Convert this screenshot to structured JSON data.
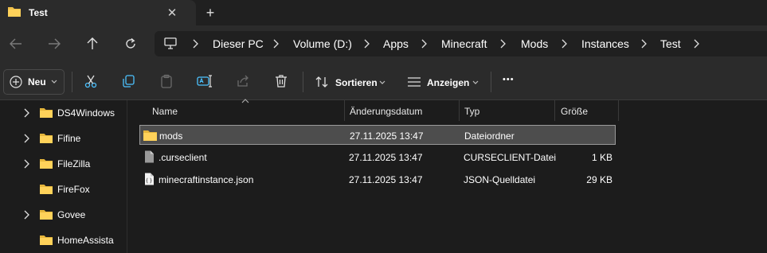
{
  "tab": {
    "title": "Test",
    "close_glyph": "✕",
    "new_tab_glyph": "+"
  },
  "nav": {
    "breadcrumbs": [
      "Dieser PC",
      "Volume (D:)",
      "Apps",
      "Minecraft",
      "Mods",
      "Instances",
      "Test"
    ]
  },
  "commands": {
    "new_label": "Neu",
    "sort_label": "Sortieren",
    "view_label": "Anzeigen",
    "more_glyph": "•••"
  },
  "sidebar": {
    "items": [
      {
        "label": "DS4Windows",
        "expandable": true
      },
      {
        "label": "Fifine",
        "expandable": true
      },
      {
        "label": "FileZilla",
        "expandable": true
      },
      {
        "label": "FireFox",
        "expandable": false
      },
      {
        "label": "Govee",
        "expandable": true
      },
      {
        "label": "HomeAssista",
        "expandable": false
      }
    ]
  },
  "table": {
    "columns": {
      "name": "Name",
      "date": "Änderungsdatum",
      "type": "Typ",
      "size": "Größe"
    },
    "rows": [
      {
        "name": "mods",
        "date": "27.11.2025 13:47",
        "type": "Dateiordner",
        "size": "",
        "icon": "folder-icon",
        "selected": true
      },
      {
        "name": ".curseclient",
        "date": "27.11.2025 13:47",
        "type": "CURSECLIENT-Datei",
        "size": "1 KB",
        "icon": "file-icon",
        "selected": false
      },
      {
        "name": "minecraftinstance.json",
        "date": "27.11.2025 13:47",
        "type": "JSON-Quelldatei",
        "size": "29 KB",
        "icon": "json-file-icon",
        "selected": false
      }
    ]
  },
  "colors": {
    "folder": "#f0c14b",
    "accent": "#4cc2ff"
  }
}
